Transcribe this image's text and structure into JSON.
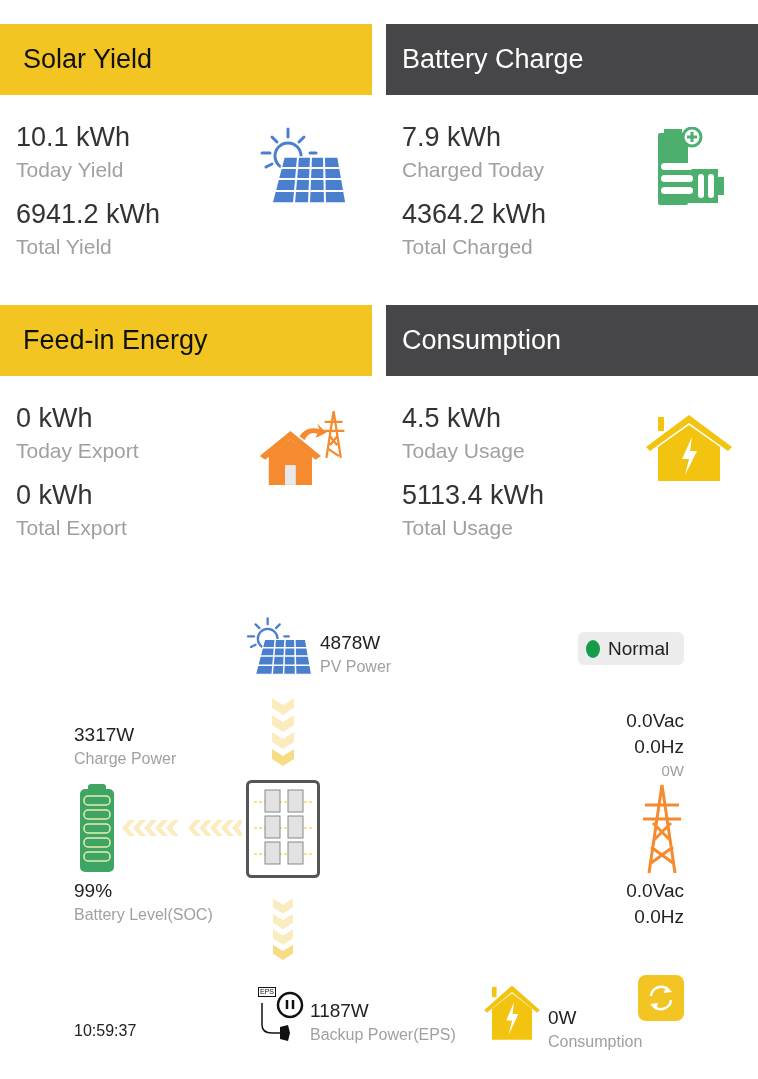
{
  "cards": [
    {
      "kind": "yield",
      "title": "Solar Yield",
      "today_value": "10.1 kWh",
      "today_label": "Today Yield",
      "total_value": "6941.2 kWh",
      "total_label": "Total Yield"
    },
    {
      "kind": "charge",
      "title": "Battery Charge",
      "today_value": "7.9 kWh",
      "today_label": "Charged Today",
      "total_value": "4364.2 kWh",
      "total_label": "Total Charged"
    },
    {
      "kind": "export",
      "title": "Feed-in Energy",
      "today_value": "0 kWh",
      "today_label": "Today Export",
      "total_value": "0 kWh",
      "total_label": "Total Export"
    },
    {
      "kind": "usage",
      "title": "Consumption",
      "today_value": "4.5 kWh",
      "today_label": "Today Usage",
      "total_value": "5113.4 kWh",
      "total_label": "Total Usage"
    }
  ],
  "flow": {
    "pv": {
      "value": "4878W",
      "label": "PV Power"
    },
    "battery": {
      "value": "3317W",
      "label": "Charge Power",
      "soc": "99%",
      "soc_label": "Battery Level(SOC)"
    },
    "status": {
      "label": "Normal",
      "color": "#149c48"
    },
    "grid": {
      "voltage_out": "0.0Vac",
      "frequency_out": "0.0Hz",
      "power": "0W",
      "voltage_in": "0.0Vac",
      "frequency_in": "0.0Hz"
    },
    "eps": {
      "tag": "EPS",
      "value": "1187W",
      "label": "Backup Power(EPS)"
    },
    "load": {
      "value": "0W",
      "label": "Consumption"
    },
    "time": "10:59:37"
  }
}
